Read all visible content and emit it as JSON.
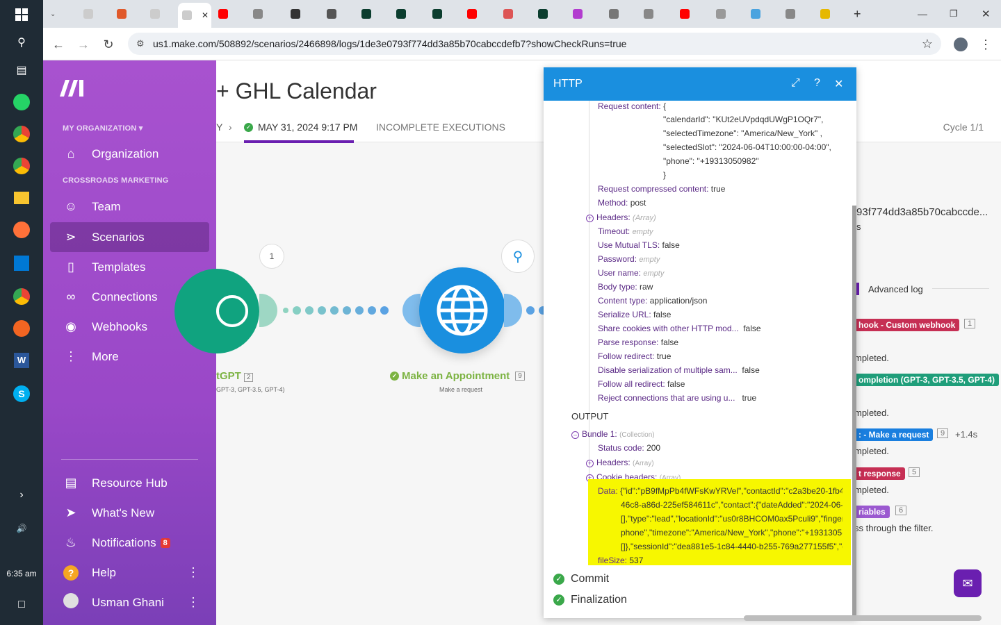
{
  "browser": {
    "url": "us1.make.com/508892/scenarios/2466898/logs/1de3e0793f774dd3a85b70cabccdefb7?showCheckRuns=true"
  },
  "taskbar": {
    "time": "6:35 am"
  },
  "sidebar": {
    "org_label": "MY ORGANIZATION",
    "team_label": "CROSSROADS MARKETING",
    "items": [
      {
        "label": "Organization",
        "icon": "home-icon"
      },
      {
        "label": "Team",
        "icon": "team-icon"
      },
      {
        "label": "Scenarios",
        "icon": "share-icon"
      },
      {
        "label": "Templates",
        "icon": "puzzle-icon"
      },
      {
        "label": "Connections",
        "icon": "link-icon"
      },
      {
        "label": "Webhooks",
        "icon": "globe-icon"
      },
      {
        "label": "More",
        "icon": "more-icon"
      }
    ],
    "bottom": [
      {
        "label": "Resource Hub"
      },
      {
        "label": "What's New"
      },
      {
        "label": "Notifications",
        "badge": "8"
      },
      {
        "label": "Help"
      },
      {
        "label": "Usman Ghani"
      }
    ]
  },
  "header": {
    "title": "+ GHL Calendar",
    "crumb_prev": "Y",
    "crumb_date": "MAY 31, 2024 9:17 PM",
    "crumb_incomplete": "INCOMPLETE EXECUTIONS",
    "cycle": "Cycle 1/1"
  },
  "canvas": {
    "bubble_count": "1",
    "gpt_label": "tGPT",
    "gpt_count": "2",
    "gpt_sub": "GPT-3, GPT-3.5, GPT-4)",
    "http_label": "Make an Appointment",
    "http_count": "9",
    "http_sub": "Make a request"
  },
  "panel": {
    "title": "HTTP",
    "request_content_key": "Request content:",
    "request_lines": [
      "{",
      "\"calendarId\": \"KUt2eUVpdqdUWgP1OQr7\",",
      "\"selectedTimezone\": \"America/New_York\" ,",
      "\"selectedSlot\": \"2024-06-04T10:00:00-04:00\",",
      "\"phone\": \"+19313050982\"",
      "}"
    ],
    "rows": [
      {
        "k": "Request compressed content:",
        "v": "true"
      },
      {
        "k": "Method:",
        "v": "post"
      },
      {
        "k": "Headers:",
        "v": "(Array)",
        "muted": true,
        "plus": true
      },
      {
        "k": "Timeout:",
        "v": "empty",
        "muted": true
      },
      {
        "k": "Use Mutual TLS:",
        "v": "false"
      },
      {
        "k": "Password:",
        "v": "empty",
        "muted": true
      },
      {
        "k": "User name:",
        "v": "empty",
        "muted": true
      },
      {
        "k": "Body type:",
        "v": "raw"
      },
      {
        "k": "Content type:",
        "v": "application/json"
      },
      {
        "k": "Serialize URL:",
        "v": "false"
      },
      {
        "k": "Share cookies with other HTTP mod...",
        "v": "false"
      },
      {
        "k": "Parse response:",
        "v": "false"
      },
      {
        "k": "Follow redirect:",
        "v": "true"
      },
      {
        "k": "Disable serialization of multiple sam...",
        "v": "false"
      },
      {
        "k": "Follow all redirect:",
        "v": "false"
      },
      {
        "k": "Reject connections that are using u...",
        "v": "true"
      }
    ],
    "output_label": "OUTPUT",
    "bundle": {
      "k": "Bundle 1:",
      "v": "(Collection)"
    },
    "status": {
      "k": "Status code:",
      "v": "200"
    },
    "headers": {
      "k": "Headers:",
      "v": "(Array)"
    },
    "cookie": {
      "k": "Cookie headers:",
      "v": "(Array)"
    },
    "data_key": "Data:",
    "data_lines": [
      "{\"id\":\"pB9fMpPb4fWFsKwYRVel\",\"contactId\":\"c2a3be20-1fb4-",
      "46c8-a86d-225ef584611c\",\"contact\":{\"dateAdded\":\"2024-06-",
      "[],\"type\":\"lead\",\"locationId\":\"us0r8BHCOM0ax5Pculi9\",\"finger",
      "phone\",\"timezone\":\"America/New_York\",\"phone\":\"+1931305(",
      "[]},\"sessionId\":\"dea881e5-1c84-4440-b255-769a277155f5\",\"e"
    ],
    "filesize": {
      "k": "fileSize:",
      "v": "537"
    },
    "commit": "Commit",
    "finalization": "Finalization"
  },
  "right": {
    "id_text": "93f774dd3a85b70cabccde...",
    "s_text": "s",
    "advanced": "Advanced log",
    "entries": [
      {
        "chip": "hook - Custom webhook",
        "color": "#c62f54",
        "count": "1",
        "status": "mpleted."
      },
      {
        "chip": "ompletion (GPT-3, GPT-3.5, GPT-4)",
        "color": "#1f9e7a",
        "count": "",
        "status": "mpleted."
      },
      {
        "chip": ": - Make a request",
        "color": "#1a7fdf",
        "count": "9",
        "extra": "+1.4s",
        "status": "mpleted."
      },
      {
        "chip": "t response",
        "color": "#c62f54",
        "count": "5",
        "status": "mpleted."
      },
      {
        "chip": "riables",
        "color": "#9b59d0",
        "count": "6",
        "status": "ss through the filter."
      }
    ]
  }
}
